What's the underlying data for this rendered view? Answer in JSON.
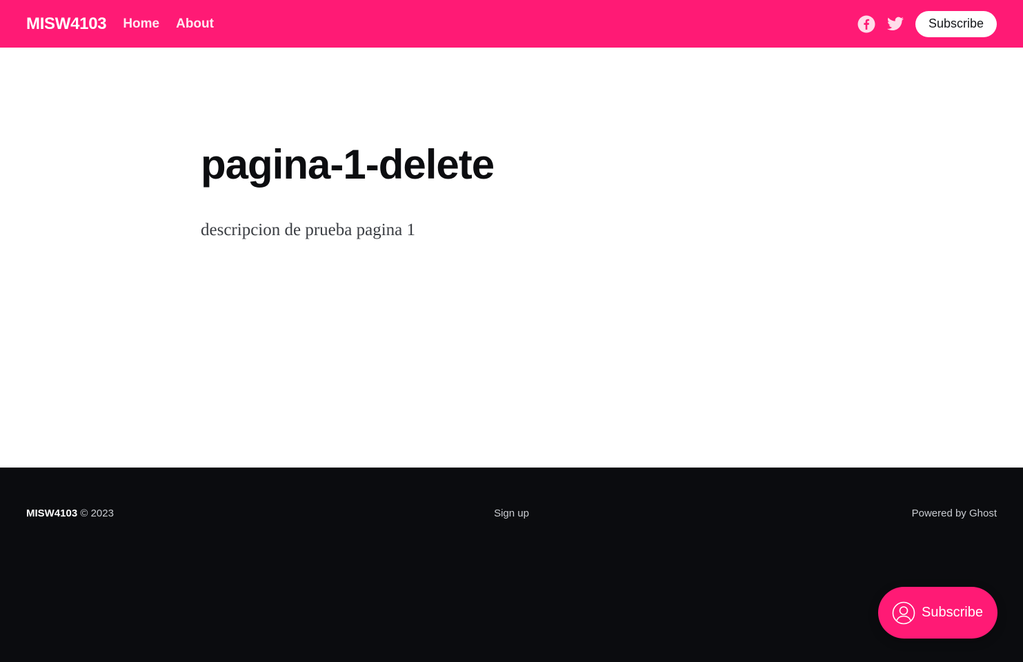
{
  "header": {
    "logo": "MISW4103",
    "nav": [
      {
        "label": "Home"
      },
      {
        "label": "About"
      }
    ],
    "social": [
      {
        "icon": "facebook-icon"
      },
      {
        "icon": "twitter-icon"
      }
    ],
    "subscribe_label": "Subscribe"
  },
  "main": {
    "title": "pagina-1-delete",
    "excerpt": "descripcion de prueba pagina 1"
  },
  "footer": {
    "brand": "MISW4103",
    "copyright": "© 2023",
    "signup_label": "Sign up",
    "powered_label": "Powered by Ghost"
  },
  "portal": {
    "label": "Subscribe",
    "icon": "user-icon"
  },
  "colors": {
    "accent": "#ff1a75",
    "footer_bg": "#0b0c0f",
    "text_dark": "#0c0d10"
  }
}
